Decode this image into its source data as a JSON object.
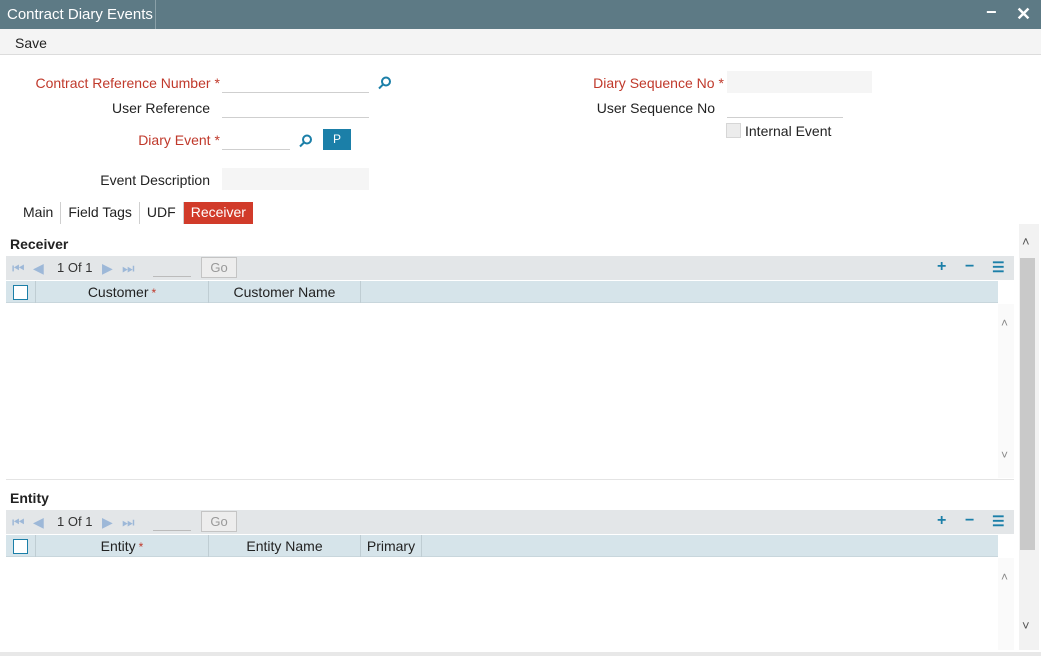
{
  "window": {
    "title": "Contract Diary Events",
    "minimize_icon": "minus",
    "close_icon": "x"
  },
  "toolbar": {
    "save_label": "Save"
  },
  "form": {
    "contract_reference_number": {
      "label": "Contract Reference Number",
      "required": "*",
      "value": ""
    },
    "user_reference": {
      "label": "User Reference",
      "value": ""
    },
    "diary_event": {
      "label": "Diary Event",
      "required": "*",
      "value": "",
      "p_button": "P"
    },
    "event_description": {
      "label": "Event Description",
      "value": ""
    },
    "diary_sequence_no": {
      "label": "Diary Sequence No",
      "required": "*",
      "value": ""
    },
    "user_sequence_no": {
      "label": "User Sequence No",
      "value": ""
    },
    "internal_event": {
      "label": "Internal Event",
      "checked": false
    }
  },
  "tabs": [
    {
      "label": "Main",
      "active": false
    },
    {
      "label": "Field Tags",
      "active": false
    },
    {
      "label": "UDF",
      "active": false
    },
    {
      "label": "Receiver",
      "active": true
    }
  ],
  "receiver": {
    "section_title": "Receiver",
    "pager": {
      "current": "1",
      "of_label": "Of",
      "total": "1",
      "go_label": "Go"
    },
    "columns": [
      {
        "label": "Customer",
        "required": "*"
      },
      {
        "label": "Customer Name"
      }
    ],
    "rows": []
  },
  "entity": {
    "section_title": "Entity",
    "pager": {
      "current": "1",
      "of_label": "Of",
      "total": "1",
      "go_label": "Go"
    },
    "columns": [
      {
        "label": "Entity",
        "required": "*"
      },
      {
        "label": "Entity Name"
      },
      {
        "label": "Primary"
      }
    ],
    "rows": []
  },
  "colors": {
    "titlebar": "#5d7a85",
    "required_label": "#c0392b",
    "active_tab": "#d13b2a",
    "accent_button": "#1b7fa8",
    "grid_header": "#d6e4ea"
  }
}
